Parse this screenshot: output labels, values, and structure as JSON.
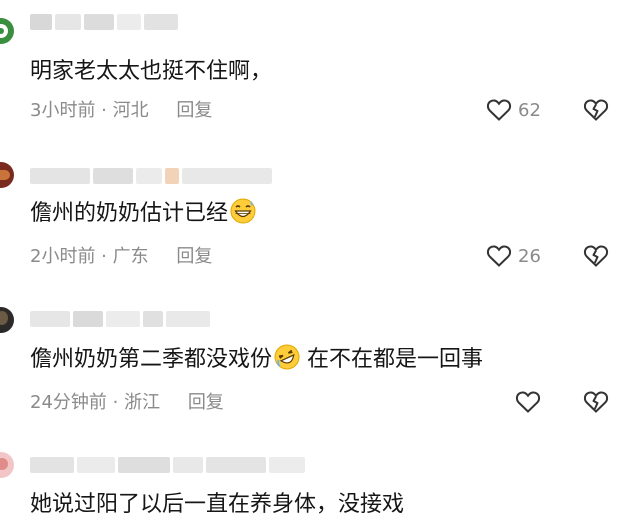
{
  "comments": [
    {
      "text": "明家老太太也挺不住啊，",
      "time": "3小时前",
      "location": "河北",
      "reply_label": "回复",
      "likes": "62"
    },
    {
      "text": "儋州的奶奶估计已经",
      "time": "2小时前",
      "location": "广东",
      "reply_label": "回复",
      "likes": "26"
    },
    {
      "text": "儋州奶奶第二季都没戏份",
      "text_after_emoji": " 在不在都是一回事",
      "time": "24分钟前",
      "location": "浙江",
      "reply_label": "回复",
      "likes": ""
    },
    {
      "text": "她说过阳了以后一直在养身体，没接戏"
    }
  ],
  "separator": " · ",
  "icons": {
    "like": "heart-outline-icon",
    "dislike": "broken-heart-icon",
    "emoji_2": "grinning-sweat-emoji",
    "emoji_3": "rolling-laughing-emoji"
  },
  "colors": {
    "text": "#161616",
    "meta": "#8a8a8a",
    "icon": "#333333"
  }
}
